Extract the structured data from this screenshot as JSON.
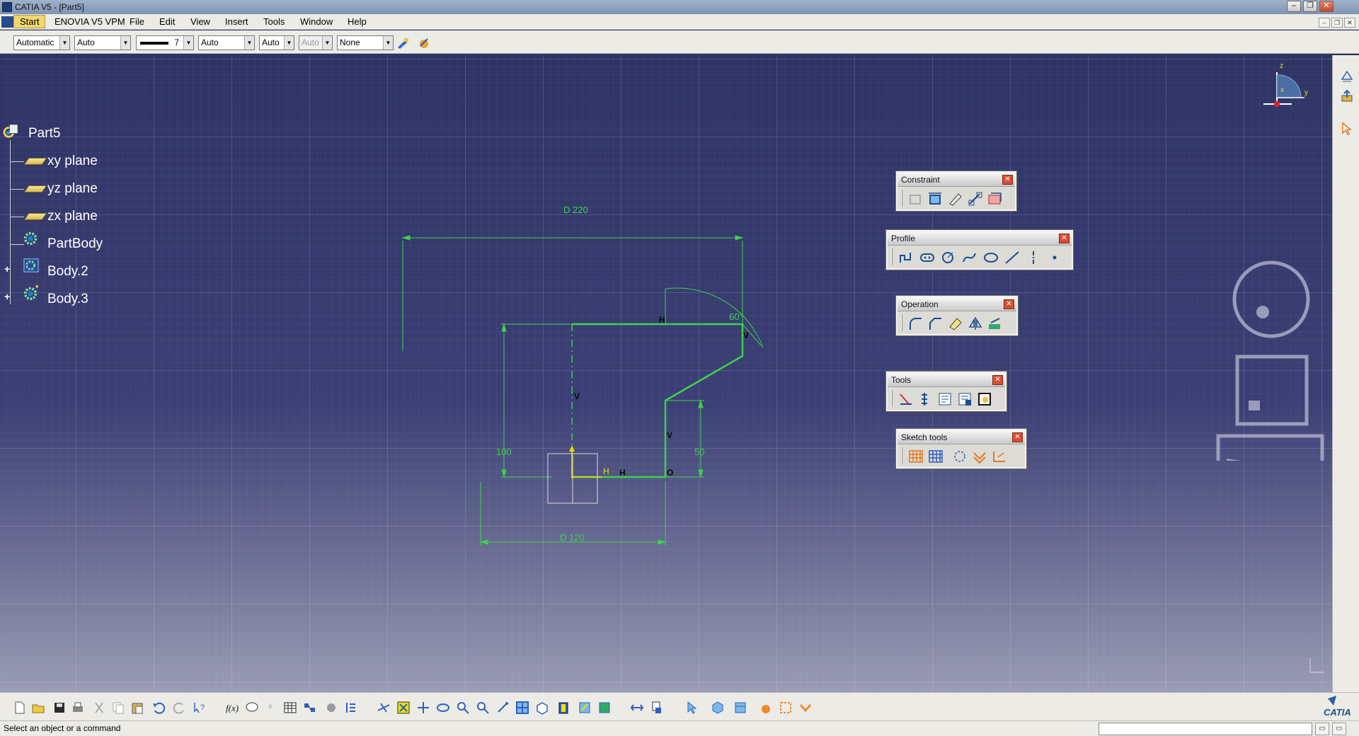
{
  "window": {
    "title": "CATIA V5 - [Part5]"
  },
  "menubar": {
    "items": [
      "Start",
      "ENOVIA V5 VPM",
      "File",
      "Edit",
      "View",
      "Insert",
      "Tools",
      "Window",
      "Help"
    ]
  },
  "graphic_properties": {
    "color": "Automatic",
    "transparency": "Auto",
    "linetype_weight": "7",
    "linetype": "Auto",
    "thickness": "Auto",
    "point_symbol": "Auto",
    "layer": "None"
  },
  "spec_tree": {
    "root": "Part5",
    "children": [
      "xy plane",
      "yz plane",
      "zx plane",
      "PartBody",
      "Body.2",
      "Body.3"
    ]
  },
  "compass": {
    "axis_x": "x",
    "axis_y": "y",
    "axis_z": "z"
  },
  "sketch": {
    "dim_top": "D 220",
    "dim_bottom": "D 120",
    "dim_left": "100",
    "dim_right": "50",
    "angle": "60°",
    "constraint_h": "H",
    "constraint_v": "V",
    "constraint_o": "O"
  },
  "toolbars": {
    "constraint": {
      "title": "Constraint"
    },
    "profile": {
      "title": "Profile"
    },
    "operation": {
      "title": "Operation"
    },
    "tools": {
      "title": "Tools"
    },
    "sketch_tools": {
      "title": "Sketch tools"
    }
  },
  "status": {
    "message": "Select an object or a command"
  },
  "brand": {
    "name": "CATIA"
  },
  "colors": {
    "viewport_bg": "#2f3466",
    "sketch_green": "#3fd24a",
    "constraint_yellow": "#f0e000",
    "menu_highlight": "#f0d670"
  }
}
